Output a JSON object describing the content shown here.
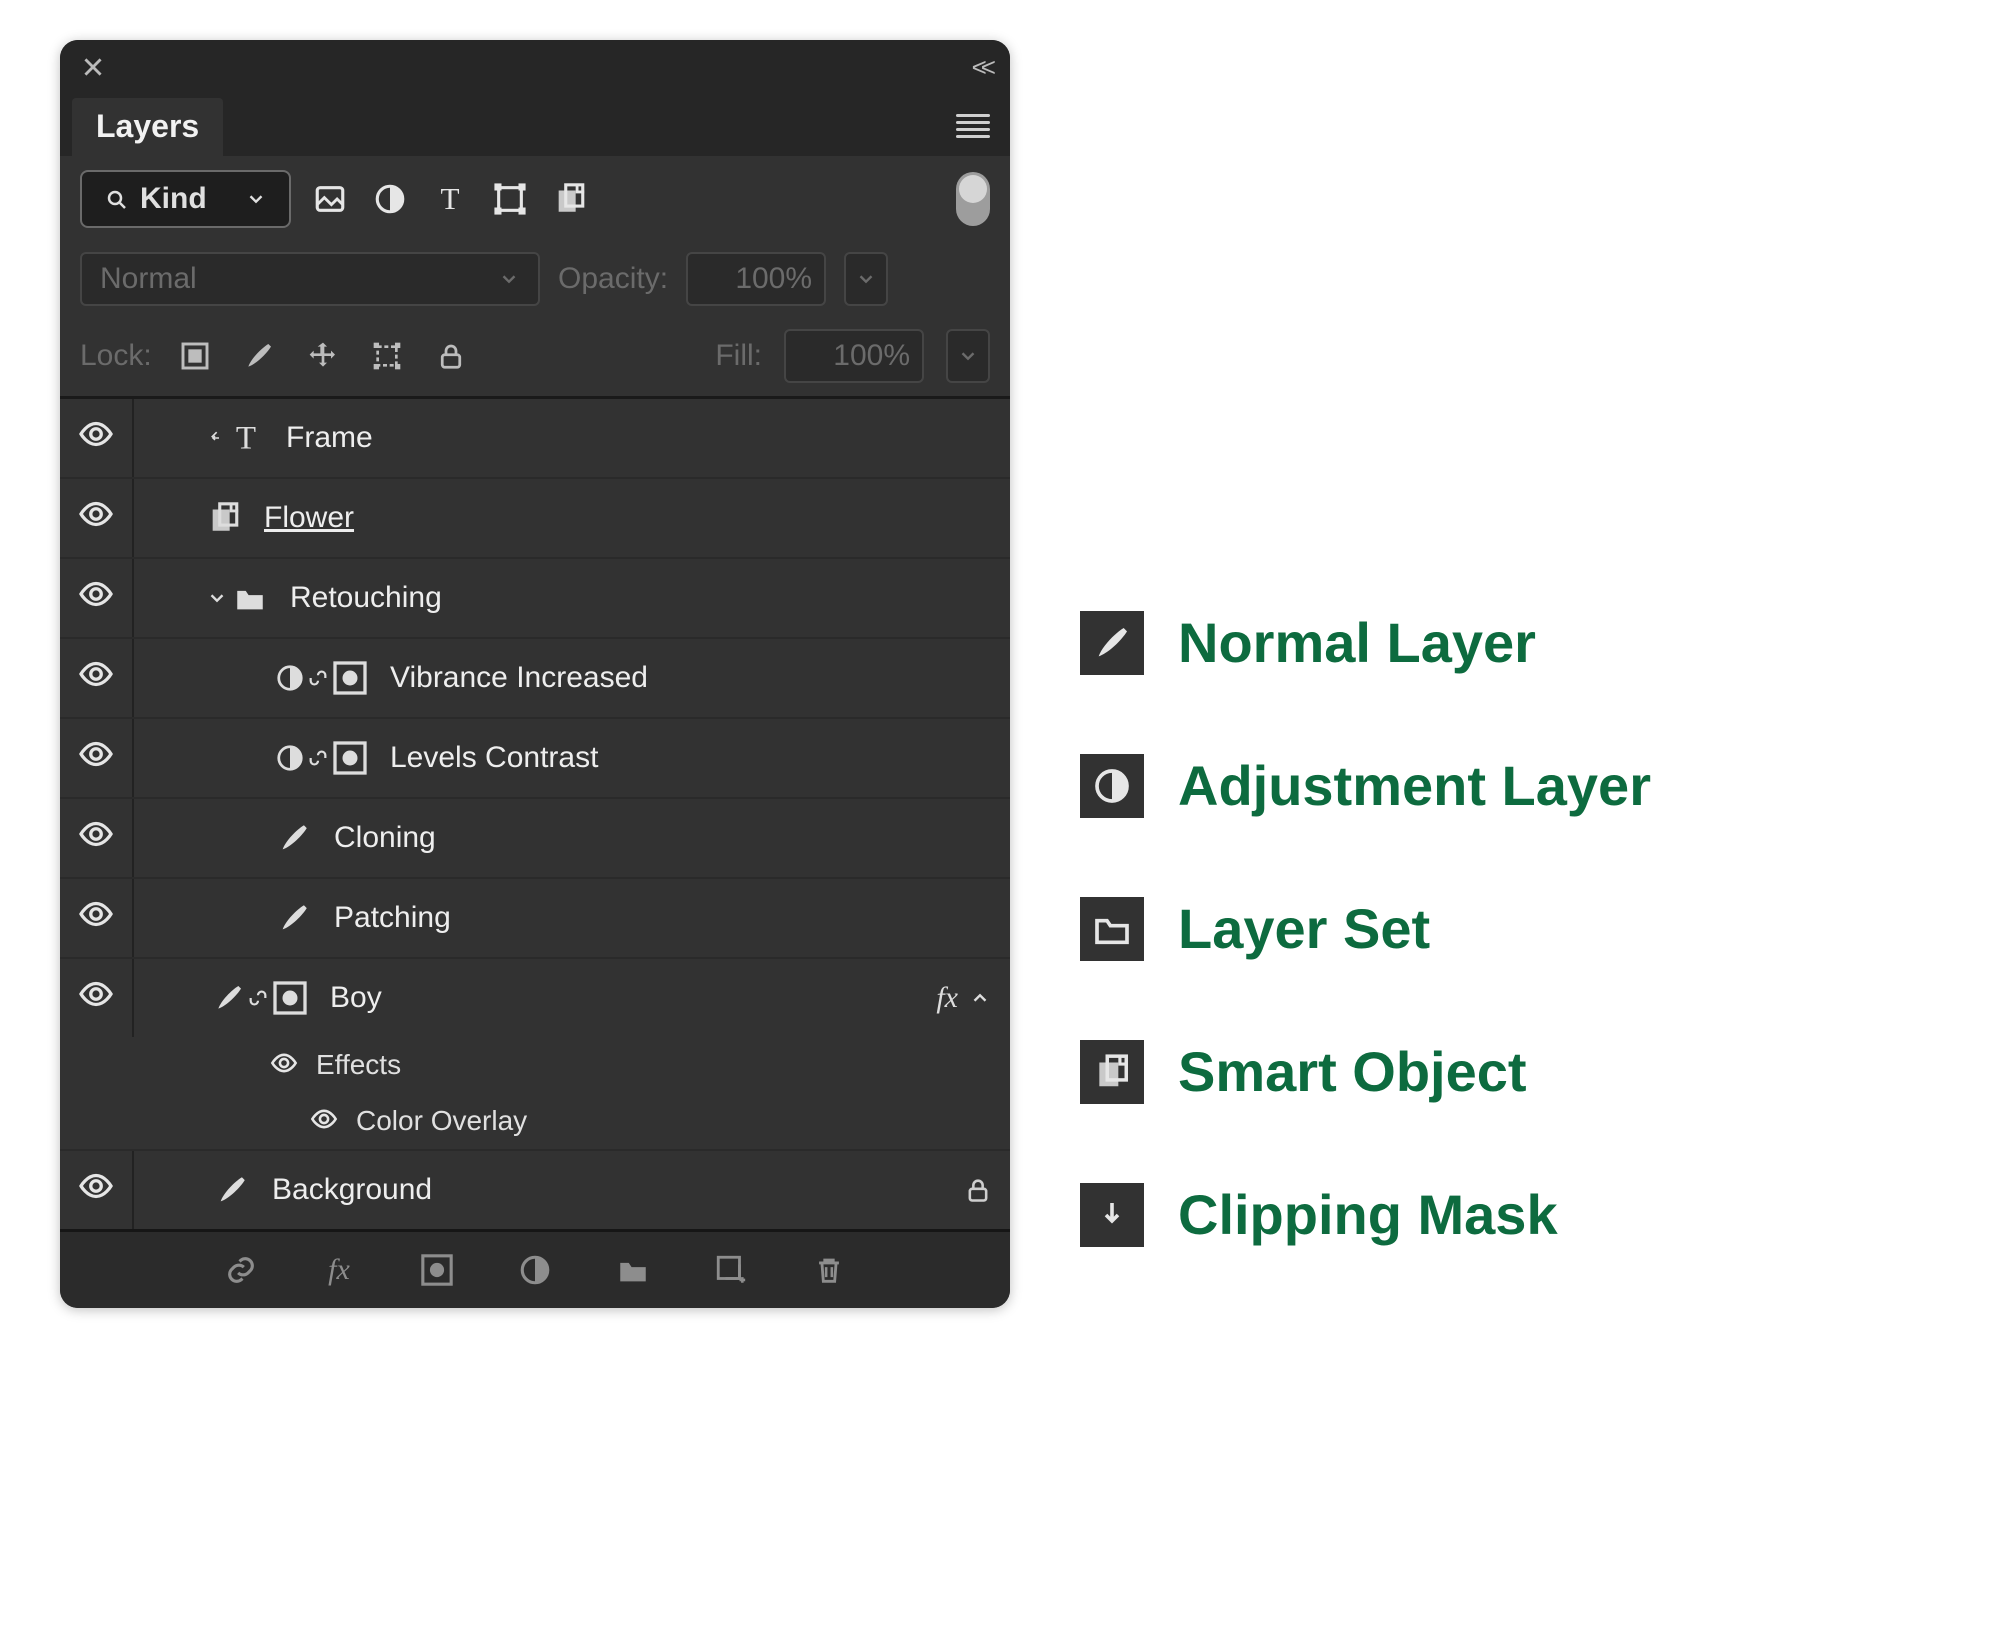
{
  "panel": {
    "tab_title": "Layers",
    "kind_label": "Kind",
    "blend_mode": "Normal",
    "opacity_label": "Opacity:",
    "opacity_value": "100%",
    "lock_label": "Lock:",
    "fill_label": "Fill:",
    "fill_value": "100%",
    "layers": [
      {
        "name": "Frame"
      },
      {
        "name": "Flower"
      },
      {
        "name": "Retouching"
      },
      {
        "name": "Vibrance Increased"
      },
      {
        "name": "Levels Contrast"
      },
      {
        "name": "Cloning"
      },
      {
        "name": "Patching"
      },
      {
        "name": "Boy"
      },
      {
        "name": "Background"
      }
    ],
    "fx_label": "fx",
    "effects_label": "Effects",
    "color_overlay_label": "Color Overlay"
  },
  "legend": [
    {
      "icon": "brush",
      "label": "Normal Layer"
    },
    {
      "icon": "adjustment",
      "label": "Adjustment Layer"
    },
    {
      "icon": "folder",
      "label": "Layer Set"
    },
    {
      "icon": "smartobject",
      "label": "Smart Object"
    },
    {
      "icon": "clipmask",
      "label": "Clipping Mask"
    }
  ]
}
